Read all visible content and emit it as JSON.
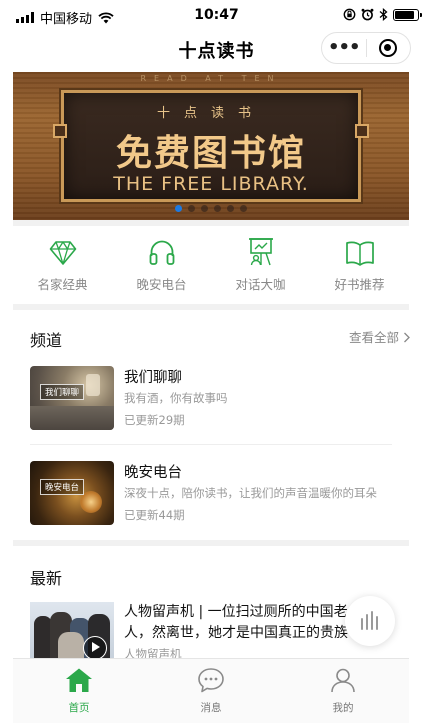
{
  "status_bar": {
    "carrier": "中国移动",
    "time": "10:47"
  },
  "nav": {
    "title": "十点读书",
    "more_label": "•••"
  },
  "banner": {
    "subtitle": "十点读书",
    "main_text": "免费图书馆",
    "english_text": "THE FREE LIBRARY.",
    "top_text": "READ AT TEN",
    "active_dot": 1,
    "dot_count": 6
  },
  "quick_nav": [
    {
      "label": "名家经典",
      "icon": "diamond-icon"
    },
    {
      "label": "晚安电台",
      "icon": "headphones-icon"
    },
    {
      "label": "对话大咖",
      "icon": "presentation-board-icon"
    },
    {
      "label": "好书推荐",
      "icon": "open-book-icon"
    }
  ],
  "channels": {
    "title": "频道",
    "see_all": "查看全部",
    "items": [
      {
        "title": "我们聊聊",
        "desc": "我有酒，你有故事吗",
        "updated": "已更新29期",
        "thumb_tag": "我们聊聊"
      },
      {
        "title": "晚安电台",
        "desc": "深夜十点，陪你读书，让我们的声音温暖你的耳朵",
        "updated": "已更新44期",
        "thumb_tag": "晚安电台"
      }
    ]
  },
  "latest": {
    "title": "最新",
    "items": [
      {
        "title": "人物留声机 | 一位扫过厕所的中国老人，然离世，她才是中国真正的贵族",
        "meta": "人物留声机"
      }
    ]
  },
  "tabbar": [
    {
      "label": "首页",
      "icon": "home-icon",
      "active": true
    },
    {
      "label": "消息",
      "icon": "message-icon",
      "active": false
    },
    {
      "label": "我的",
      "icon": "profile-icon",
      "active": false
    }
  ],
  "colors": {
    "accent_green": "#2ba84a",
    "banner_dot_active": "#1e7ae0"
  }
}
